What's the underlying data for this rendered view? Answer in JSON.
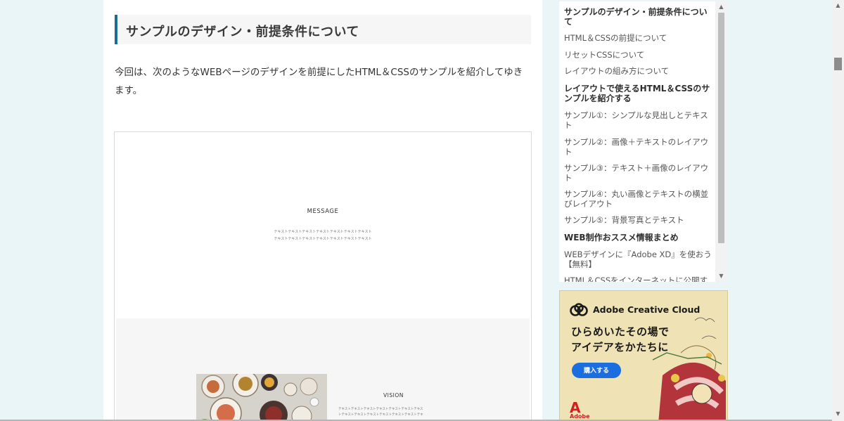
{
  "article": {
    "heading": "サンプルのデザイン・前提条件について",
    "paragraph": "今回は、次のようなWEBページのデザインを前提にしたHTML＆CSSのサンプルを紹介してゆきます。"
  },
  "preview": {
    "message_title": "MESSAGE",
    "message_lines": [
      "テキストテキストテキストテキストテキストテキストテキスト",
      "テキストテキストテキストテキストテキストテキストテキスト"
    ],
    "vision_title": "VISION",
    "vision_lines": [
      "テキストテキストテキストテキストテキストテキストテキス",
      "トテキストテキストテキストテキストテキストテキストテキ"
    ]
  },
  "toc": {
    "items": [
      {
        "label": "サンプルのデザイン・前提条件について",
        "heading": true
      },
      {
        "label": "HTML＆CSSの前提について",
        "heading": false
      },
      {
        "label": "リセットCSSについて",
        "heading": false
      },
      {
        "label": "レイアウトの組み方について",
        "heading": false
      },
      {
        "label": "レイアウトで使えるHTML＆CSSのサンプルを紹介する",
        "heading": true
      },
      {
        "label": "サンプル①：シンプルな見出しとテキスト",
        "heading": false
      },
      {
        "label": "サンプル②：画像＋テキストのレイアウト",
        "heading": false
      },
      {
        "label": "サンプル③：テキスト＋画像のレイアウト",
        "heading": false
      },
      {
        "label": "サンプル④：丸い画像とテキストの横並びレイアウト",
        "heading": false
      },
      {
        "label": "サンプル⑤：背景写真とテキスト",
        "heading": false
      },
      {
        "label": "WEB制作おススメ情報まとめ",
        "heading": true
      },
      {
        "label": "WEBデザインに『Adobe XD』を使おう【無料】",
        "heading": false
      },
      {
        "label": "HTML＆CSSをインターネットに公開する",
        "heading": false
      }
    ]
  },
  "ad": {
    "brand": "Adobe Creative Cloud",
    "line1": "ひらめいたその場で",
    "line2": "アイデアをかたちに",
    "button": "購入する",
    "footer_logo": "A",
    "footer_text": "Adobe",
    "brand_color": "#d11f1f",
    "button_color": "#1b6ee0"
  },
  "icons": {
    "scroll_up": "▲",
    "scroll_down": "▼"
  }
}
